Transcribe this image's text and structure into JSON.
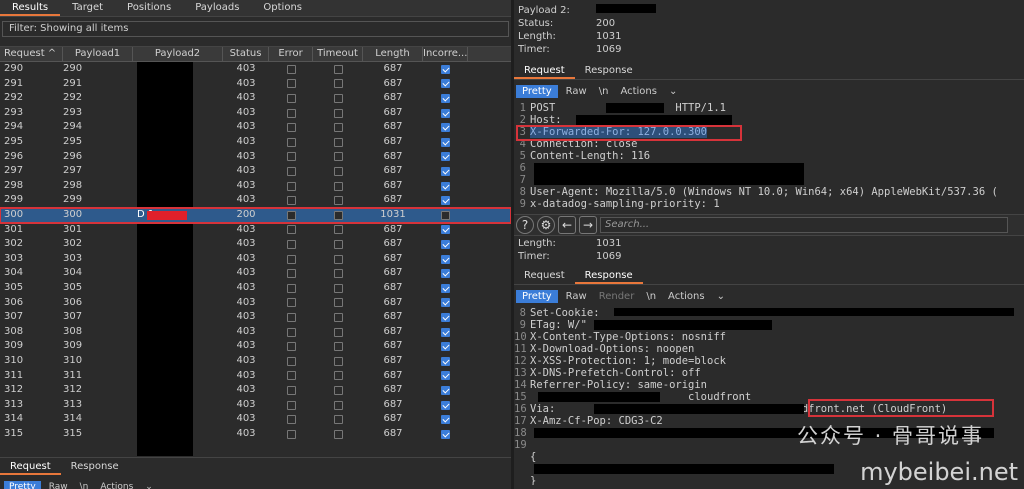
{
  "left_tabs": [
    "Results",
    "Target",
    "Positions",
    "Payloads",
    "Options"
  ],
  "filter_text": "Filter: Showing all items",
  "columns": {
    "request": "Request ^",
    "payload1": "Payload1",
    "payload2": "Payload2",
    "status": "Status",
    "error": "Error",
    "timeout": "Timeout",
    "length": "Length",
    "incorrect": "Incorre..."
  },
  "rows": [
    {
      "req": "290",
      "p1": "290",
      "p2": "",
      "st": "403",
      "len": "687",
      "inc": true
    },
    {
      "req": "291",
      "p1": "291",
      "p2": "",
      "st": "403",
      "len": "687",
      "inc": true
    },
    {
      "req": "292",
      "p1": "292",
      "p2": "",
      "st": "403",
      "len": "687",
      "inc": true
    },
    {
      "req": "293",
      "p1": "293",
      "p2": "",
      "st": "403",
      "len": "687",
      "inc": true
    },
    {
      "req": "294",
      "p1": "294",
      "p2": "",
      "st": "403",
      "len": "687",
      "inc": true
    },
    {
      "req": "295",
      "p1": "295",
      "p2": "",
      "st": "403",
      "len": "687",
      "inc": true
    },
    {
      "req": "296",
      "p1": "296",
      "p2": "",
      "st": "403",
      "len": "687",
      "inc": true
    },
    {
      "req": "297",
      "p1": "297",
      "p2": "",
      "st": "403",
      "len": "687",
      "inc": true
    },
    {
      "req": "298",
      "p1": "298",
      "p2": "",
      "st": "403",
      "len": "687",
      "inc": true
    },
    {
      "req": "299",
      "p1": "299",
      "p2": "",
      "st": "403",
      "len": "687",
      "inc": true
    },
    {
      "req": "300",
      "p1": "300",
      "p2": "D 1",
      "st": "200",
      "len": "1031",
      "inc": false,
      "selected": true
    },
    {
      "req": "301",
      "p1": "301",
      "p2": "",
      "st": "403",
      "len": "687",
      "inc": true
    },
    {
      "req": "302",
      "p1": "302",
      "p2": "",
      "st": "403",
      "len": "687",
      "inc": true
    },
    {
      "req": "303",
      "p1": "303",
      "p2": "",
      "st": "403",
      "len": "687",
      "inc": true
    },
    {
      "req": "304",
      "p1": "304",
      "p2": "",
      "st": "403",
      "len": "687",
      "inc": true
    },
    {
      "req": "305",
      "p1": "305",
      "p2": "",
      "st": "403",
      "len": "687",
      "inc": true
    },
    {
      "req": "306",
      "p1": "306",
      "p2": "",
      "st": "403",
      "len": "687",
      "inc": true
    },
    {
      "req": "307",
      "p1": "307",
      "p2": "",
      "st": "403",
      "len": "687",
      "inc": true
    },
    {
      "req": "308",
      "p1": "308",
      "p2": "",
      "st": "403",
      "len": "687",
      "inc": true
    },
    {
      "req": "309",
      "p1": "309",
      "p2": "",
      "st": "403",
      "len": "687",
      "inc": true
    },
    {
      "req": "310",
      "p1": "310",
      "p2": "",
      "st": "403",
      "len": "687",
      "inc": true
    },
    {
      "req": "311",
      "p1": "311",
      "p2": "",
      "st": "403",
      "len": "687",
      "inc": true
    },
    {
      "req": "312",
      "p1": "312",
      "p2": "",
      "st": "403",
      "len": "687",
      "inc": true
    },
    {
      "req": "313",
      "p1": "313",
      "p2": "",
      "st": "403",
      "len": "687",
      "inc": true
    },
    {
      "req": "314",
      "p1": "314",
      "p2": "",
      "st": "403",
      "len": "687",
      "inc": true
    },
    {
      "req": "315",
      "p1": "315",
      "p2": "",
      "st": "403",
      "len": "687",
      "inc": true
    }
  ],
  "left_bottom_tabs": [
    "Request",
    "Response"
  ],
  "left_bottom_tools": [
    "Pretty",
    "Raw",
    "\\n",
    "Actions"
  ],
  "info_top": {
    "payload2_label": "Payload 2:",
    "status_label": "Status:",
    "status_value": "200",
    "length_label": "Length:",
    "length_value": "1031",
    "timer_label": "Timer:",
    "timer_value": "1069"
  },
  "req_tabs": [
    "Request",
    "Response"
  ],
  "req_tools": [
    "Pretty",
    "Raw",
    "\\n",
    "Actions"
  ],
  "request_lines": [
    {
      "n": "1",
      "t": "POST                   HTTP/1.1"
    },
    {
      "n": "2",
      "t": "Host:"
    },
    {
      "n": "3",
      "t": "X-Forwarded-For: 127.0.0.300"
    },
    {
      "n": "4",
      "t": "Connection: close"
    },
    {
      "n": "5",
      "t": "Content-Length: 116"
    },
    {
      "n": "6",
      "t": ""
    },
    {
      "n": "7",
      "t": ""
    },
    {
      "n": "8",
      "t": "User-Agent: Mozilla/5.0 (Windows NT 10.0; Win64; x64) AppleWebKit/537.36 ("
    },
    {
      "n": "9",
      "t": "x-datadog-sampling-priority: 1"
    }
  ],
  "search_placeholder": "Search...",
  "info_mid": {
    "length_label": "Length:",
    "length_value": "1031",
    "timer_label": "Timer:",
    "timer_value": "1069"
  },
  "resp_tabs": [
    "Request",
    "Response"
  ],
  "resp_tools": [
    "Pretty",
    "Raw",
    "Render",
    "\\n",
    "Actions"
  ],
  "response_lines": [
    {
      "n": "8",
      "t": "Set-Cookie:"
    },
    {
      "n": "9",
      "t": "ETag: W/\""
    },
    {
      "n": "10",
      "t": "X-Content-Type-Options: nosniff"
    },
    {
      "n": "11",
      "t": "X-Download-Options: noopen"
    },
    {
      "n": "12",
      "t": "X-XSS-Protection: 1; mode=block"
    },
    {
      "n": "13",
      "t": "X-DNS-Prefetch-Control: off"
    },
    {
      "n": "14",
      "t": "Referrer-Policy: same-origin"
    },
    {
      "n": "15",
      "t": "                         cloudfront"
    },
    {
      "n": "16",
      "t": "Via:                                   cloudfront.net (CloudFront)"
    },
    {
      "n": "17",
      "t": "X-Amz-Cf-Pop: CDG3-C2"
    },
    {
      "n": "18",
      "t": ""
    },
    {
      "n": "19",
      "t": ""
    },
    {
      "n": "",
      "t": "{"
    },
    {
      "n": "",
      "t": ""
    },
    {
      "n": "",
      "t": "}"
    }
  ],
  "watermark": {
    "line1": "公众号 · 骨哥说事",
    "line2": "mybeibei.net"
  }
}
